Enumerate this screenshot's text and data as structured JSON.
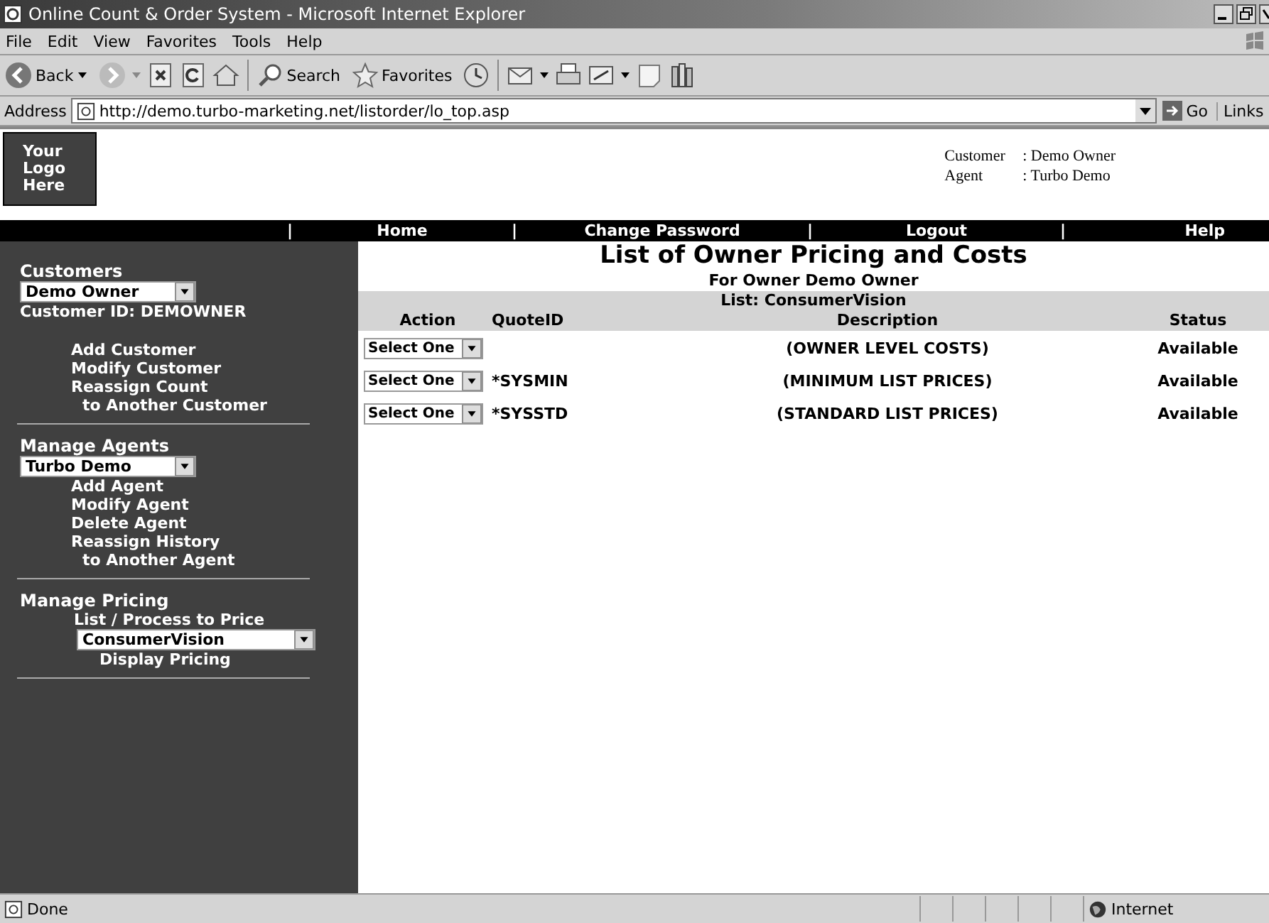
{
  "window": {
    "title": "Online Count & Order System - Microsoft Internet Explorer"
  },
  "menu": [
    "File",
    "Edit",
    "View",
    "Favorites",
    "Tools",
    "Help"
  ],
  "toolbar": {
    "back": "Back",
    "search": "Search",
    "favorites": "Favorites"
  },
  "address": {
    "label": "Address",
    "url": "http://demo.turbo-marketing.net/listorder/lo_top.asp",
    "go": "Go",
    "links": "Links"
  },
  "header": {
    "logo": [
      "Your",
      "Logo",
      "Here"
    ],
    "info": [
      {
        "label": "Customer",
        "value": ": Demo Owner"
      },
      {
        "label": "Agent",
        "value": ": Turbo Demo"
      }
    ]
  },
  "nav": [
    {
      "kind": "separator",
      "text": "|"
    },
    {
      "kind": "link",
      "text": "Home"
    },
    {
      "kind": "separator",
      "text": "|"
    },
    {
      "kind": "link",
      "text": "Change Password"
    },
    {
      "kind": "separator",
      "text": "|"
    },
    {
      "kind": "link",
      "text": "Logout"
    },
    {
      "kind": "separator",
      "text": "|"
    },
    {
      "kind": "link",
      "text": "Help"
    }
  ],
  "sidebar": {
    "sections": [
      {
        "heading": "Customers",
        "select": "Demo Owner",
        "note": "Customer ID: DEMOWNER",
        "links": [
          "Add Customer",
          "Modify Customer",
          "Reassign Count",
          "to Another Customer"
        ]
      },
      {
        "heading": "Manage Agents",
        "select": "Turbo Demo",
        "links": [
          "Add Agent",
          "Modify Agent",
          "Delete Agent",
          "Reassign History",
          "to Another Agent"
        ]
      },
      {
        "heading": "Manage Pricing",
        "sub": "List / Process to Price",
        "select": "ConsumerVision",
        "links": [
          "Display Pricing"
        ]
      }
    ]
  },
  "content": {
    "title": "List of Owner Pricing and Costs",
    "subtitle": "For Owner Demo Owner",
    "list": "List: ConsumerVision",
    "columns": [
      "Action",
      "QuoteID",
      "Description",
      "Status"
    ],
    "rows": [
      {
        "action": "Select One",
        "quote_id": "",
        "description": "(OWNER LEVEL COSTS)",
        "status": "Available"
      },
      {
        "action": "Select One",
        "quote_id": "*SYSMIN",
        "description": "(MINIMUM LIST PRICES)",
        "status": "Available"
      },
      {
        "action": "Select One",
        "quote_id": "*SYSSTD",
        "description": "(STANDARD LIST PRICES)",
        "status": "Available"
      }
    ]
  },
  "status_bar": {
    "text": "Done",
    "zone": "Internet"
  }
}
